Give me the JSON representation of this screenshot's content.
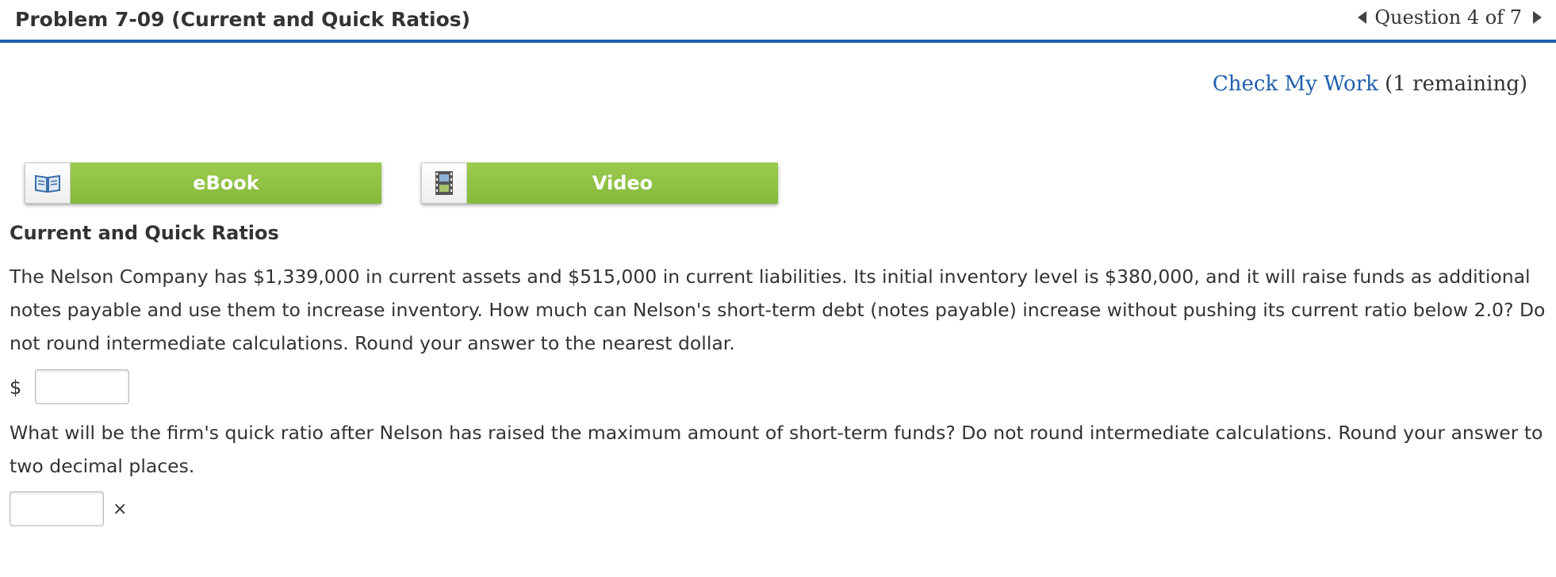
{
  "header": {
    "title": "Problem 7-09 (Current and Quick Ratios)",
    "question_nav": "Question 4 of 7"
  },
  "check_work": {
    "link_label": "Check My Work",
    "remaining": "(1 remaining)"
  },
  "resources": {
    "ebook_label": "eBook",
    "video_label": "Video"
  },
  "content": {
    "section_title": "Current and Quick Ratios",
    "question1": "The Nelson Company has $1,339,000 in current assets and $515,000 in current liabilities. Its initial inventory level is $380,000, and it will raise funds as additional notes payable and use them to increase inventory. How much can Nelson's short-term debt (notes payable) increase without pushing its current ratio below 2.0? Do not round intermediate calculations. Round your answer to the nearest dollar.",
    "answer1_prefix": "$",
    "answer1_value": "",
    "question2": "What will be the firm's quick ratio after Nelson has raised the maximum amount of short-term funds? Do not round intermediate calculations. Round your answer to two decimal places.",
    "answer2_value": "",
    "answer2_suffix": "×"
  },
  "colors": {
    "accent_blue": "#1f5fae",
    "button_green": "#8fc144",
    "text": "#333333"
  },
  "icons": {
    "ebook": "book-icon",
    "video": "film-icon",
    "prev": "triangle-left-icon",
    "next": "triangle-right-icon"
  }
}
